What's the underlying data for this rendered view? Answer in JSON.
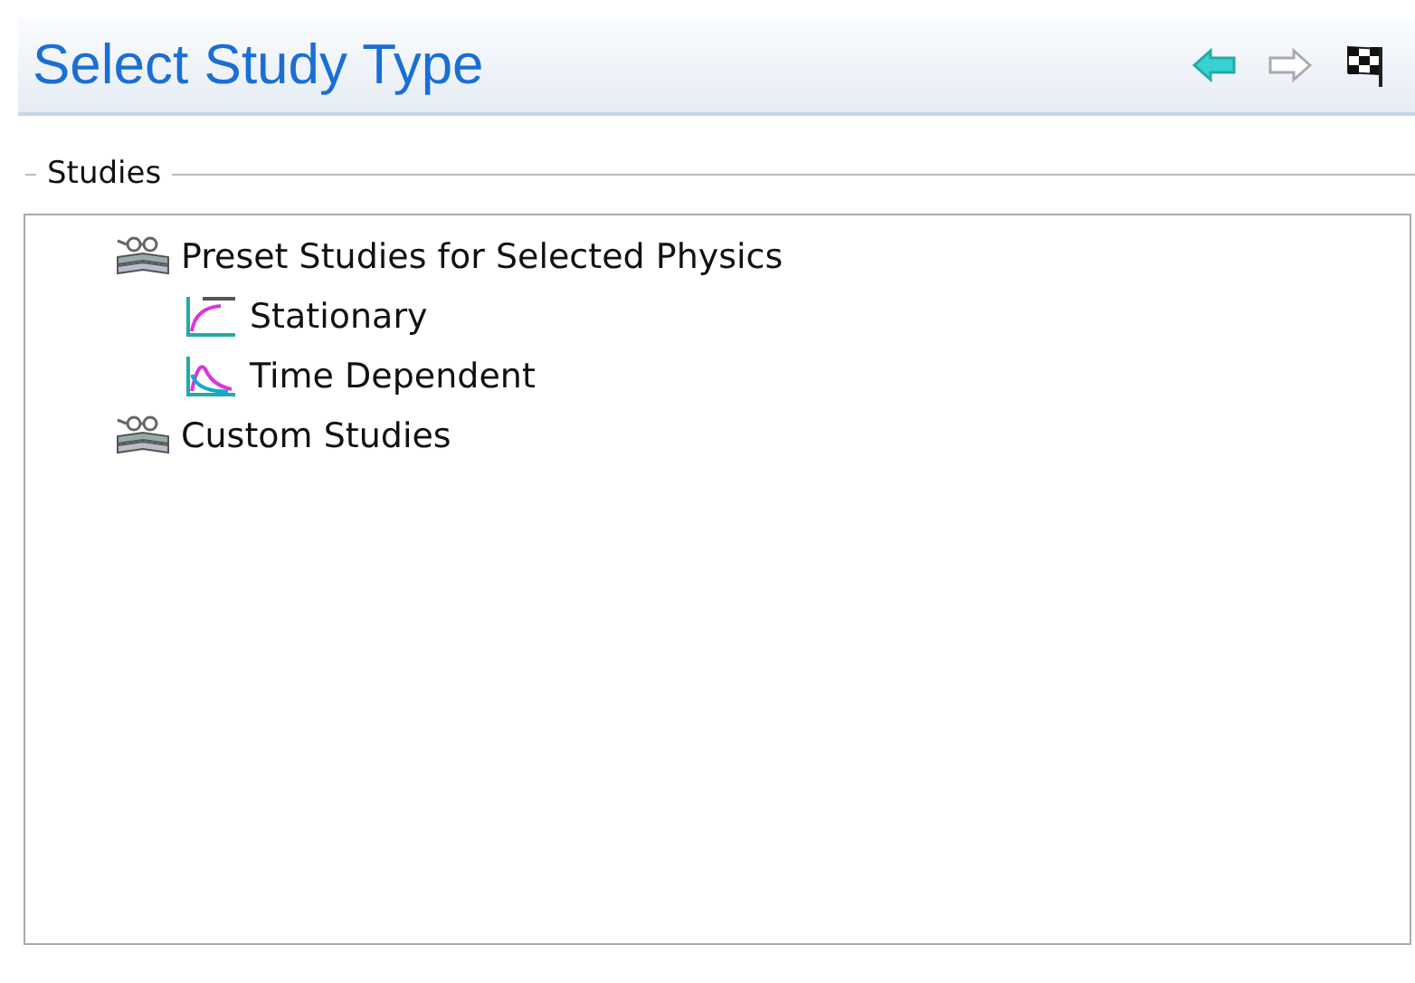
{
  "header": {
    "title": "Select Study Type",
    "buttons": [
      {
        "kind": "back",
        "disabled": false
      },
      {
        "kind": "forward",
        "disabled": true
      },
      {
        "kind": "finish",
        "disabled": false
      }
    ]
  },
  "studies": {
    "label": "Studies",
    "tree": [
      {
        "label": "Preset Studies for Selected Physics",
        "kind": "folder",
        "children": [
          {
            "label": "Stationary",
            "kind": "stationary"
          },
          {
            "label": "Time Dependent",
            "kind": "time"
          }
        ]
      },
      {
        "label": "Custom Studies",
        "kind": "folder"
      }
    ]
  }
}
